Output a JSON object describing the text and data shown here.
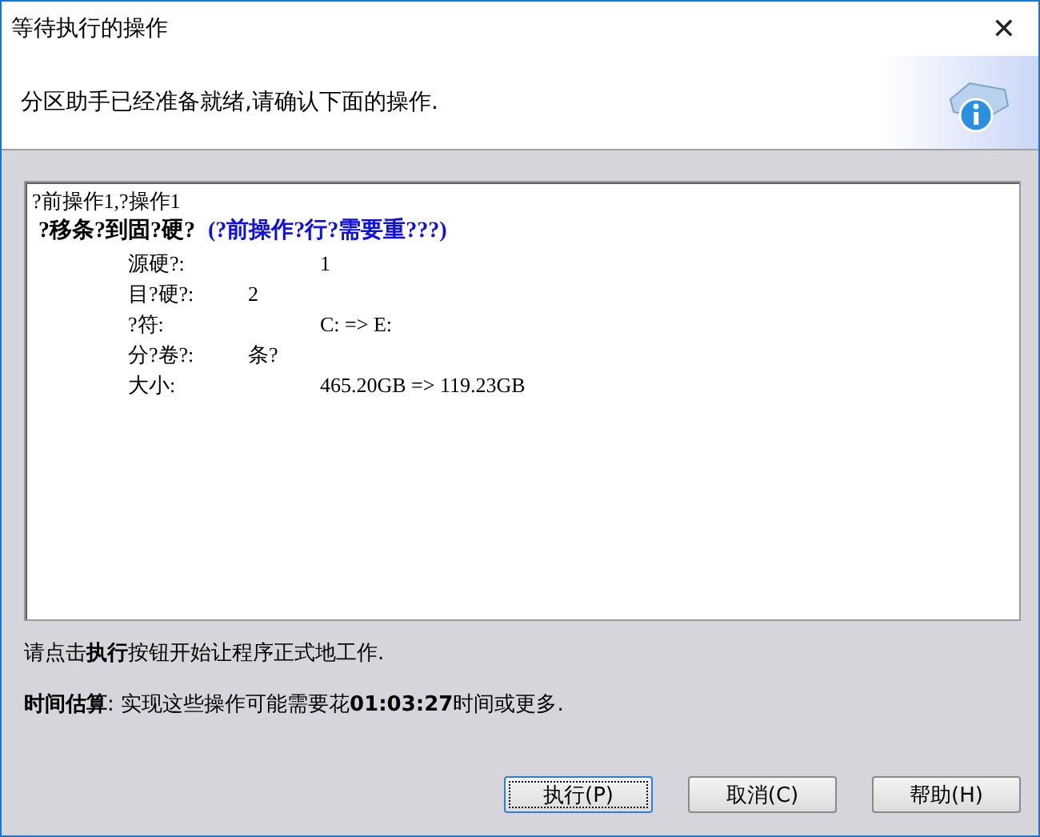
{
  "window": {
    "title": "等待执行的操作",
    "close": "✕"
  },
  "header": {
    "message": "分区助手已经准备就绪,请确认下面的操作."
  },
  "operations": {
    "summary": "?前操作1,?操作1",
    "items": [
      {
        "title": "?移条?到固?硬?",
        "note": "(?前操作?行?需要重???)",
        "details": [
          {
            "kind": "column",
            "label": "源硬?:",
            "value": "1"
          },
          {
            "kind": "inline",
            "label": "目?硬?:",
            "value": "2"
          },
          {
            "kind": "column",
            "label": "?符:",
            "value": "C: => E:"
          },
          {
            "kind": "inline",
            "label": "分?卷?:",
            "value": "条?"
          },
          {
            "kind": "column",
            "label": "大小:",
            "value": "465.20GB => 119.23GB"
          }
        ]
      }
    ]
  },
  "instruction": "请点击**执行**按钮开始让程序正式地工作.",
  "estimate": "**时间估算**: 实现这些操作可能需要花**01:03:27**时间或更多.",
  "buttons": [
    {
      "label": "执行(P)",
      "default": true
    },
    {
      "label": "取消(C)",
      "default": false
    },
    {
      "label": "帮助(H)",
      "default": false
    }
  ]
}
